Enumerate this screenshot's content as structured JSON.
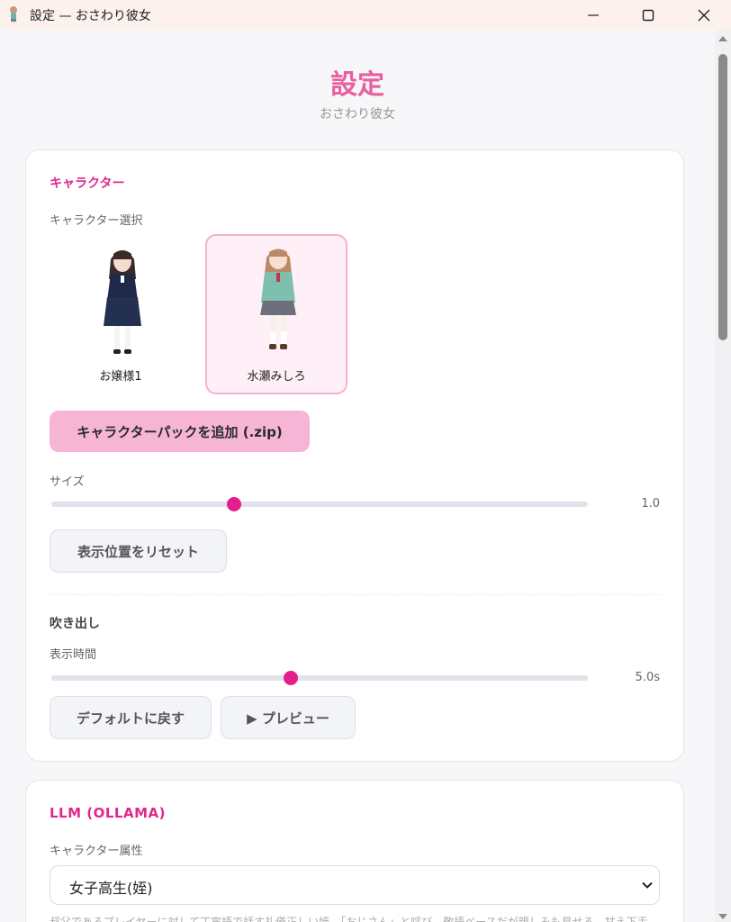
{
  "window": {
    "title": "設定 — おさわり彼女"
  },
  "header": {
    "title": "設定",
    "subtitle": "おさわり彼女"
  },
  "character_section": {
    "title": "キャラクター",
    "select_label": "キャラクター選択",
    "characters": [
      {
        "name": "お嬢様1",
        "selected": false
      },
      {
        "name": "水瀬みしろ",
        "selected": true
      }
    ],
    "add_pack_label": "キャラクターパックを追加 (.zip)",
    "size_label": "サイズ",
    "size_value": "1.0",
    "size_fraction": 0.34,
    "reset_position_label": "表示位置をリセット",
    "bubble_title": "吹き出し",
    "display_time_label": "表示時間",
    "display_time_value": "5.0s",
    "display_time_fraction": 0.447,
    "default_label": "デフォルトに戻す",
    "preview_label": "▶ プレビュー"
  },
  "llm_section": {
    "title": "LLM (OLLAMA)",
    "attribute_label": "キャラクター属性",
    "attribute_value": "女子高生(姪)",
    "description": "叔父であるプレイヤーに対して丁寧語で話す礼儀正しい姪。「おじさん」と呼び、敬語ベースだが親しみも見せる。甘え下手"
  },
  "colors": {
    "accent": "#e0288d",
    "title_pink": "#e8609f",
    "button_pink": "#f7b5d6",
    "selected_tile_bg": "#fff0f7",
    "selected_tile_border": "#f3b2d2"
  },
  "icons": {
    "app": "girl-character-icon",
    "minimize": "minimize-icon",
    "maximize": "maximize-icon",
    "close": "close-icon",
    "dropdown": "chevron-down-icon"
  }
}
